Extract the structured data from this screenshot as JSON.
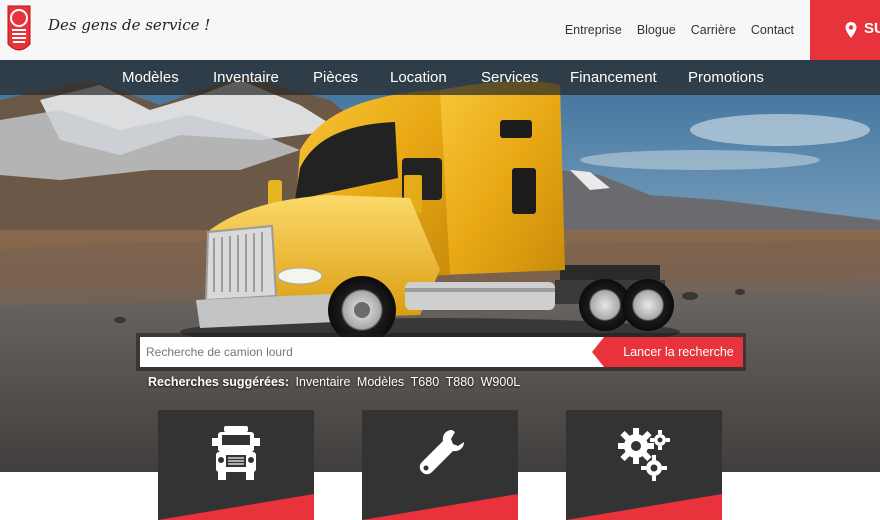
{
  "brand": {
    "tagline": "Des gens de service !",
    "accent": "#e8323c"
  },
  "toplinks": [
    "Entreprise",
    "Blogue",
    "Carrière",
    "Contact"
  ],
  "locate_label": "SU",
  "nav": [
    "Modèles",
    "Inventaire",
    "Pièces",
    "Location",
    "Services",
    "Financement",
    "Promotions"
  ],
  "search": {
    "placeholder": "Recherche de camion lourd",
    "button_label": "Lancer la recherche"
  },
  "suggestions": {
    "label": "Recherches suggérées:",
    "items": [
      "Inventaire",
      "Modèles",
      "T680",
      "T880",
      "W900L"
    ]
  },
  "cards": [
    {
      "icon": "truck-icon"
    },
    {
      "icon": "wrench-icon"
    },
    {
      "icon": "gears-icon"
    }
  ]
}
